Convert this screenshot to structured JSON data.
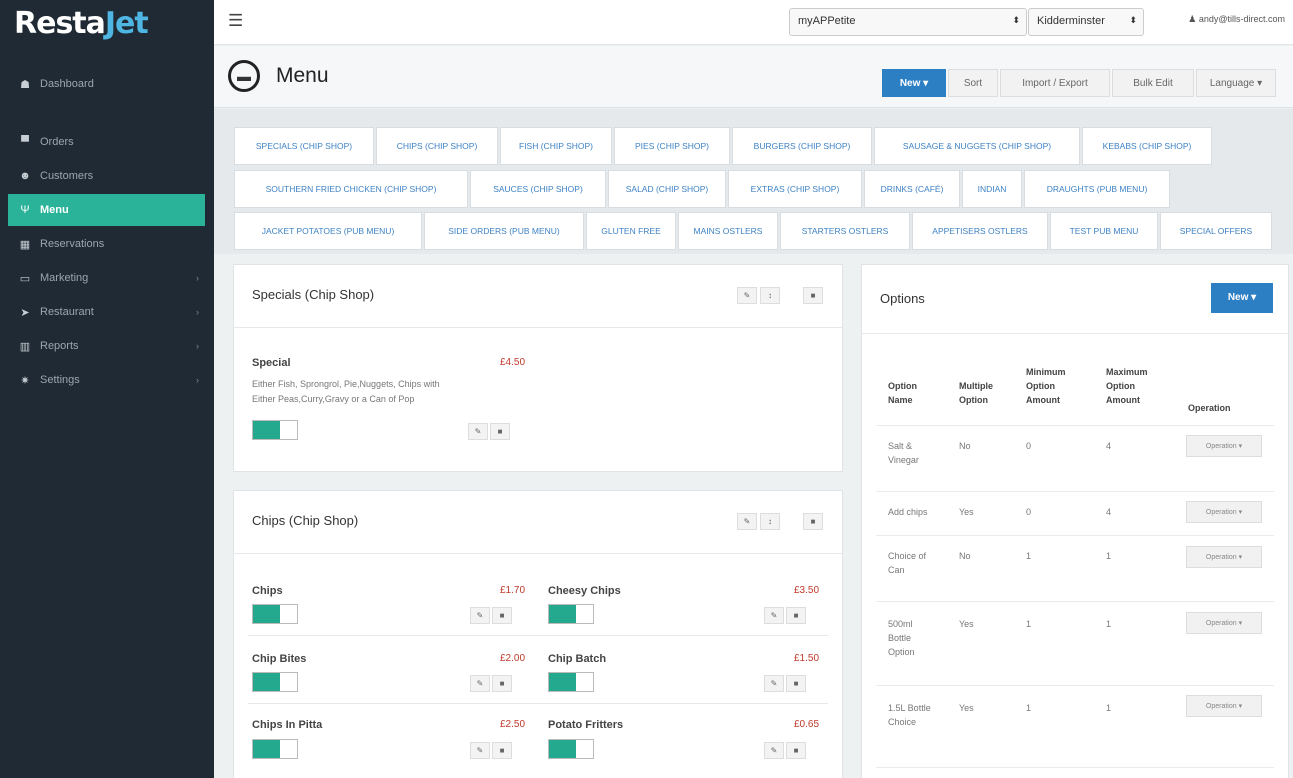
{
  "app": {
    "logo_part1": "Resta",
    "logo_part2": "Jet"
  },
  "sidebar": {
    "items": [
      {
        "label": "Dashboard",
        "icon": "tachometer-icon",
        "glyph": "☗"
      },
      {
        "label": "Orders",
        "icon": "cart-icon",
        "glyph": "▀"
      },
      {
        "label": "Customers",
        "icon": "users-icon",
        "glyph": "☻"
      },
      {
        "label": "Menu",
        "icon": "cutlery-icon",
        "glyph": "Ψ"
      },
      {
        "label": "Reservations",
        "icon": "calendar-icon",
        "glyph": "▦"
      },
      {
        "label": "Marketing",
        "icon": "marketing-icon",
        "glyph": "▭"
      },
      {
        "label": "Restaurant",
        "icon": "plane-icon",
        "glyph": "➤"
      },
      {
        "label": "Reports",
        "icon": "bar-chart-icon",
        "glyph": "▥"
      },
      {
        "label": "Settings",
        "icon": "gear-icon",
        "glyph": "✷"
      }
    ],
    "chevron": "›"
  },
  "topbar": {
    "site_select": "myAPPetite",
    "location_select": "Kidderminster",
    "user_email": "andy@tills-direct.com",
    "select_arrow": "⬍"
  },
  "header": {
    "title": "Menu",
    "buttons": {
      "new": "New ▾",
      "sort": "Sort",
      "import_export": "Import / Export",
      "bulk_edit": "Bulk Edit",
      "language": "Language ▾"
    }
  },
  "tabs": [
    "SPECIALS (CHIP SHOP)",
    "CHIPS (CHIP SHOP)",
    "FISH (CHIP SHOP)",
    "PIES (CHIP SHOP)",
    "BURGERS (CHIP SHOP)",
    "SAUSAGE & NUGGETS (CHIP SHOP)",
    "KEBABS (CHIP SHOP)",
    "SOUTHERN FRIED CHICKEN (CHIP SHOP)",
    "SAUCES (CHIP SHOP)",
    "SALAD (CHIP SHOP)",
    "EXTRAS (CHIP SHOP)",
    "DRINKS (CAFÉ)",
    "INDIAN",
    "DRAUGHTS (PUB MENU)",
    "JACKET POTATOES (PUB MENU)",
    "SIDE ORDERS (PUB MENU)",
    "GLUTEN FREE",
    "MAINS OSTLERS",
    "STARTERS OSTLERS",
    "APPETISERS OSTLERS",
    "TEST PUB MENU",
    "SPECIAL OFFERS"
  ],
  "icons": {
    "edit": "✎",
    "move": "↕",
    "delete": "■"
  },
  "specials": {
    "title": "Specials (Chip Shop)",
    "item": {
      "name": "Special",
      "price": "£4.50",
      "desc1": "Either Fish, Sprongrol, Pie,Nuggets, Chips with",
      "desc2": "Either Peas,Curry,Gravy or a Can of Pop",
      "enabled": true
    }
  },
  "chips": {
    "title": "Chips (Chip Shop)",
    "items": [
      {
        "name": "Chips",
        "price": "£1.70",
        "enabled": true
      },
      {
        "name": "Cheesy Chips",
        "price": "£3.50",
        "enabled": true
      },
      {
        "name": "Chip Bites",
        "price": "£2.00",
        "enabled": true
      },
      {
        "name": "Chip Batch",
        "price": "£1.50",
        "enabled": true
      },
      {
        "name": "Chips In Pitta",
        "price": "£2.50",
        "enabled": true
      },
      {
        "name": "Potato Fritters",
        "price": "£0.65",
        "enabled": true
      }
    ]
  },
  "options": {
    "title": "Options",
    "new_button": "New ▾",
    "columns": {
      "name": "Option Name",
      "multiple": "Multiple Option",
      "min": "Minimum Option Amount",
      "max": "Maximum Option Amount",
      "operation": "Operation"
    },
    "operation_button": "Operation ▾",
    "rows": [
      {
        "name": "Salt & Vinegar",
        "multiple": "No",
        "min": "0",
        "max": "4"
      },
      {
        "name": "Add chips",
        "multiple": "Yes",
        "min": "0",
        "max": "4"
      },
      {
        "name": "Choice of Can",
        "multiple": "No",
        "min": "1",
        "max": "1"
      },
      {
        "name": "500ml Bottle Option",
        "multiple": "Yes",
        "min": "1",
        "max": "1"
      },
      {
        "name": "1.5L Bottle Choice",
        "multiple": "Yes",
        "min": "1",
        "max": "1"
      }
    ]
  },
  "colors": {
    "sidebar_bg": "#1f2a34",
    "accent_green": "#2bb39a",
    "primary_blue": "#2d7fc4",
    "price_red": "#c0392b",
    "tab_link": "#3e82c4"
  }
}
